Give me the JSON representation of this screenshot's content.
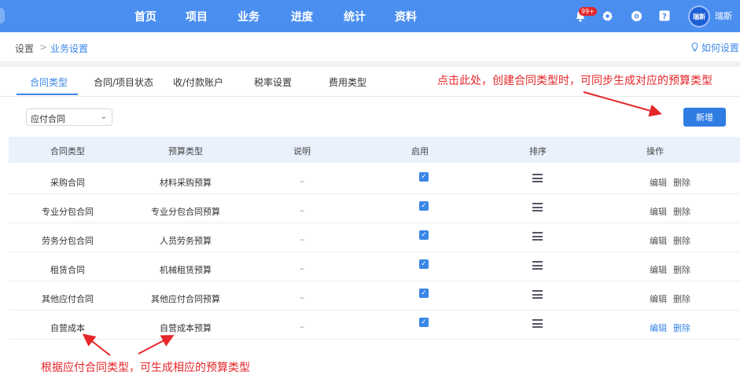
{
  "nav": {
    "items": [
      "首页",
      "项目",
      "业务",
      "进度",
      "统计",
      "资料"
    ],
    "notification_badge": "99+",
    "avatar_text": "瑞斯",
    "username": "瑞斯"
  },
  "breadcrumb": {
    "root": "设置",
    "separator": ">",
    "current": "业务设置"
  },
  "howto_label": "如何设置",
  "tabs": [
    "合同类型",
    "合同/项目状态",
    "收/付款账户",
    "税率设置",
    "费用类型"
  ],
  "active_tab": "合同类型",
  "annotations": {
    "top": "点击此处，创建合同类型时，可同步生成对应的预算类型",
    "bottom": "根据应付合同类型，可生成相应的预算类型"
  },
  "filter": {
    "selected": "应付合同"
  },
  "new_button": "新增",
  "table": {
    "headers": [
      "合同类型",
      "预算类型",
      "说明",
      "启用",
      "排序",
      "操作"
    ],
    "rows": [
      {
        "contract_type": "采购合同",
        "budget_type": "材料采购预算",
        "note": "–",
        "enabled": true,
        "edit": "编辑",
        "delete": "删除"
      },
      {
        "contract_type": "专业分包合同",
        "budget_type": "专业分包合同预算",
        "note": "–",
        "enabled": true,
        "edit": "编辑",
        "delete": "删除"
      },
      {
        "contract_type": "劳务分包合同",
        "budget_type": "人员劳务预算",
        "note": "–",
        "enabled": true,
        "edit": "编辑",
        "delete": "删除"
      },
      {
        "contract_type": "租赁合同",
        "budget_type": "机械租赁预算",
        "note": "–",
        "enabled": true,
        "edit": "编辑",
        "delete": "删除"
      },
      {
        "contract_type": "其他应付合同",
        "budget_type": "其他应付合同预算",
        "note": "–",
        "enabled": true,
        "edit": "编辑",
        "delete": "删除"
      },
      {
        "contract_type": "自营成本",
        "budget_type": "自营成本预算",
        "note": "–",
        "enabled": true,
        "edit": "编辑",
        "delete": "删除"
      }
    ]
  },
  "colors": {
    "nav_bg": "#4a8ff0",
    "accent": "#3c87e8",
    "annotation": "#e5262a",
    "header_bg": "#eaf1fc"
  }
}
